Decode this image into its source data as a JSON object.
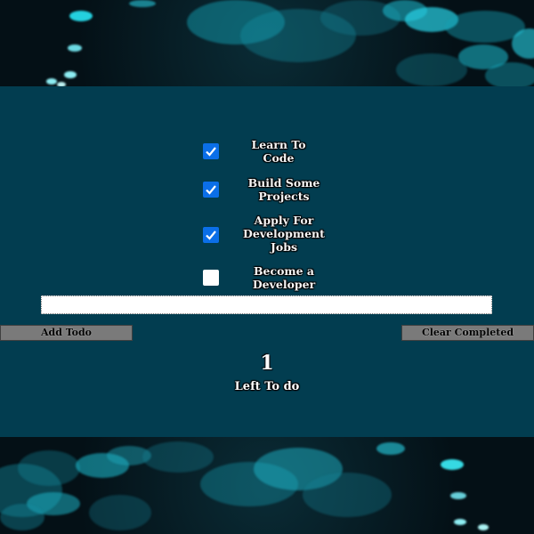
{
  "todos": [
    {
      "label": "Learn To Code",
      "checked": true
    },
    {
      "label": "Build Some Projects",
      "checked": true
    },
    {
      "label": "Apply For Development Jobs",
      "checked": true
    },
    {
      "label": "Become a Developer",
      "checked": false
    }
  ],
  "input": {
    "value": "",
    "placeholder": ""
  },
  "buttons": {
    "add_label": "Add Todo",
    "clear_label": "Clear Completed"
  },
  "counter": {
    "count": "1",
    "label": "Left To do"
  },
  "colors": {
    "panel": "#023d50",
    "checkbox_checked": "#0b6fe8",
    "button": "#7a7a7a",
    "bokeh_accent": "#18d4e0"
  },
  "icons": {
    "check": "checkmark-icon"
  }
}
